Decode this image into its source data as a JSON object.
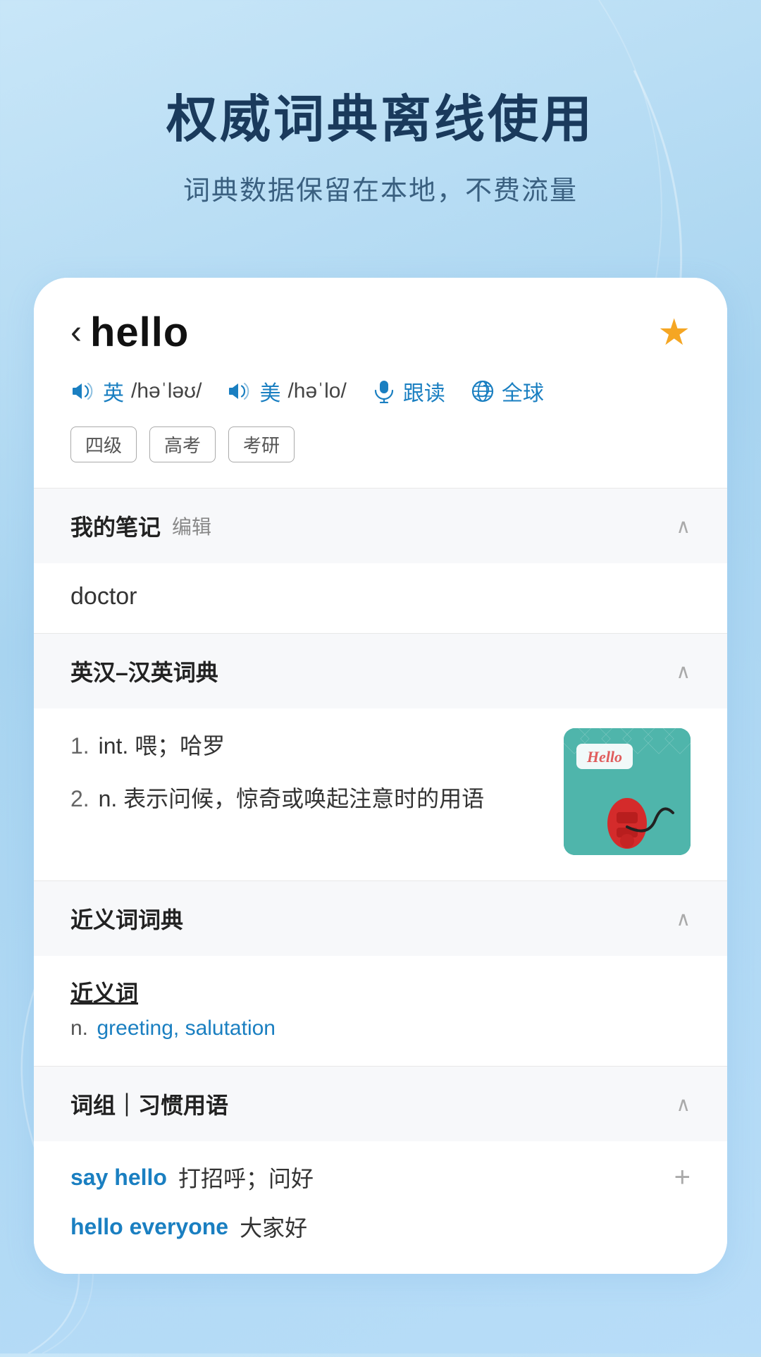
{
  "background": {
    "gradient_start": "#c8e6f8",
    "gradient_end": "#a8d4f0"
  },
  "top_section": {
    "main_title": "权威词典离线使用",
    "sub_title": "词典数据保留在本地，不费流量"
  },
  "card": {
    "word_header": {
      "back_arrow": "‹",
      "word": "hello",
      "star_filled": "★",
      "phonetics": [
        {
          "flag": "英",
          "ipa": "/həˈləʊ/"
        },
        {
          "flag": "美",
          "ipa": "/həˈlo/"
        }
      ],
      "actions": [
        {
          "label": "跟读"
        },
        {
          "label": "全球"
        }
      ],
      "tags": [
        "四级",
        "高考",
        "考研"
      ]
    },
    "notes_section": {
      "title": "我的笔记",
      "edit_label": "编辑",
      "content": "doctor"
    },
    "dict_section": {
      "title": "英汉–汉英词典",
      "definitions": [
        {
          "num": "1.",
          "pos": "int.",
          "text": "喂；哈罗"
        },
        {
          "num": "2.",
          "pos": "n.",
          "text": "表示问候，惊奇或唤起注意时的用语"
        }
      ],
      "image_label": "Hello"
    },
    "synonyms_section": {
      "title": "近义词词典",
      "category": "近义词",
      "pos": "n.",
      "words": "greeting, salutation"
    },
    "phrases_section": {
      "title": "词组｜习惯用语",
      "phrases": [
        {
          "phrase": "say hello",
          "meaning": "打招呼；问好",
          "has_add": true
        },
        {
          "phrase": "hello everyone",
          "meaning": "大家好",
          "has_add": false
        }
      ]
    }
  }
}
